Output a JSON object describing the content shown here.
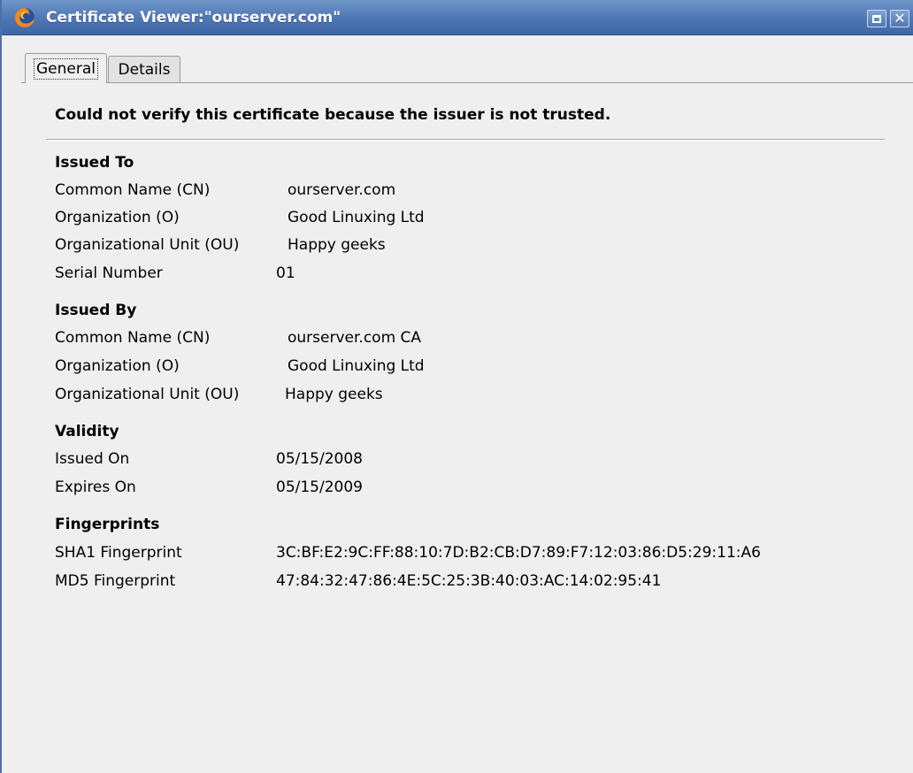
{
  "window": {
    "title": "Certificate Viewer:\"ourserver.com\"",
    "icon": "firefox-icon",
    "maximize_icon": "maximize-icon",
    "close_glyph": "✕"
  },
  "tabs": [
    {
      "label": "General",
      "selected": true
    },
    {
      "label": "Details",
      "selected": false
    }
  ],
  "warning": "Could not verify this certificate because the issuer is not trusted.",
  "issued_to": {
    "title": "Issued To",
    "rows": [
      {
        "label": "Common Name (CN)",
        "value": "ourserver.com"
      },
      {
        "label": "Organization (O)",
        "value": "Good Linuxing Ltd"
      },
      {
        "label": "Organizational Unit (OU)",
        "value": "Happy geeks"
      },
      {
        "label": "Serial Number",
        "value": "01"
      }
    ]
  },
  "issued_by": {
    "title": "Issued By",
    "rows": [
      {
        "label": "Common Name (CN)",
        "value": "ourserver.com CA"
      },
      {
        "label": "Organization (O)",
        "value": "Good Linuxing Ltd"
      },
      {
        "label": "Organizational Unit (OU)",
        "value": "Happy geeks"
      }
    ]
  },
  "validity": {
    "title": "Validity",
    "rows": [
      {
        "label": "Issued On",
        "value": "05/15/2008"
      },
      {
        "label": "Expires On",
        "value": "05/15/2009"
      }
    ]
  },
  "fingerprints": {
    "title": "Fingerprints",
    "rows": [
      {
        "label": "SHA1 Fingerprint",
        "value": "3C:BF:E2:9C:FF:88:10:7D:B2:CB:D7:89:F7:12:03:86:D5:29:11:A6"
      },
      {
        "label": "MD5 Fingerprint",
        "value": "47:84:32:47:86:4E:5C:25:3B:40:03:AC:14:02:95:41"
      }
    ]
  },
  "colors": {
    "titlebar": "#4f76b3",
    "background": "#efefef"
  }
}
